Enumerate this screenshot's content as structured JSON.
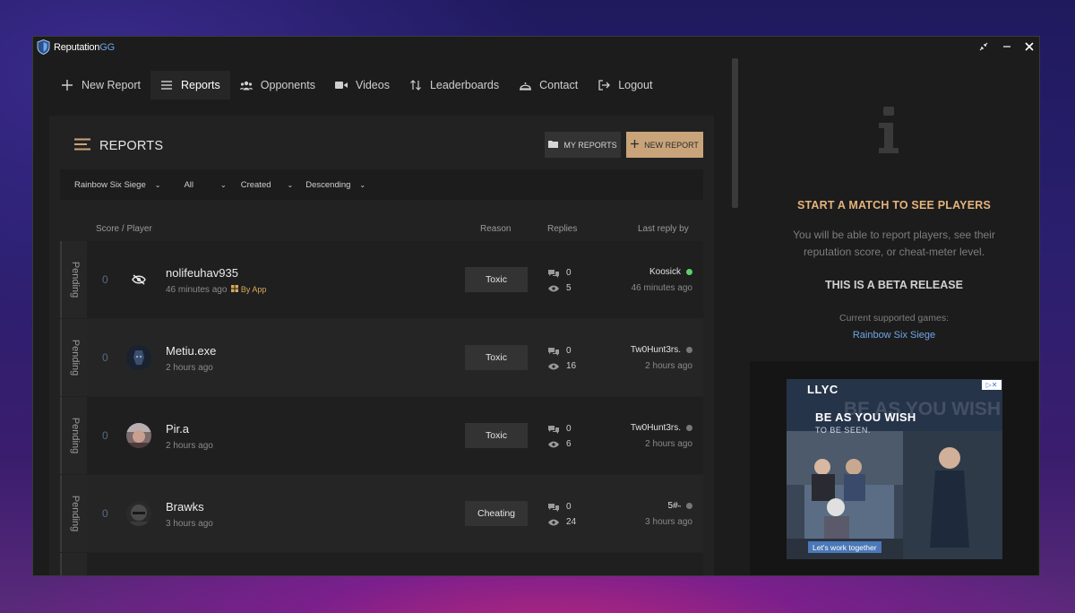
{
  "app": {
    "title_main": "Reputation",
    "title_accent": "GG"
  },
  "window_controls": [
    "restore",
    "minimize",
    "close"
  ],
  "nav": [
    {
      "label": "New Report",
      "icon": "plus-icon"
    },
    {
      "label": "Reports",
      "icon": "list-icon",
      "active": true
    },
    {
      "label": "Opponents",
      "icon": "users-icon"
    },
    {
      "label": "Videos",
      "icon": "video-icon"
    },
    {
      "label": "Leaderboards",
      "icon": "sort-icon"
    },
    {
      "label": "Contact",
      "icon": "bell-icon"
    },
    {
      "label": "Logout",
      "icon": "logout-icon"
    }
  ],
  "panel": {
    "title": "REPORTS",
    "my_reports_label": "MY REPORTS",
    "new_report_label": "NEW REPORT"
  },
  "filters": [
    {
      "value": "Rainbow Six Siege"
    },
    {
      "value": "All"
    },
    {
      "value": "Created"
    },
    {
      "value": "Descending"
    }
  ],
  "columns": {
    "score_player": "Score / Player",
    "reason": "Reason",
    "replies": "Replies",
    "last_reply_by": "Last reply by"
  },
  "rows": [
    {
      "status": "Pending",
      "score": "0",
      "player": "nolifeuhav935",
      "time": "46 minutes ago",
      "by_app": "By App",
      "reason": "Toxic",
      "replies": "0",
      "views": "5",
      "last_by": "Koosick",
      "last_online": true,
      "last_time": "46 minutes ago"
    },
    {
      "status": "Pending",
      "score": "0",
      "player": "Metiu.exe",
      "time": "2 hours ago",
      "by_app": "",
      "reason": "Toxic",
      "replies": "0",
      "views": "16",
      "last_by": "Tw0Hunt3rs.",
      "last_online": false,
      "last_time": "2 hours ago"
    },
    {
      "status": "Pending",
      "score": "0",
      "player": "Pir.a",
      "time": "2 hours ago",
      "by_app": "",
      "reason": "Toxic",
      "replies": "0",
      "views": "6",
      "last_by": "Tw0Hunt3rs.",
      "last_online": false,
      "last_time": "2 hours ago"
    },
    {
      "status": "Pending",
      "score": "0",
      "player": "Brawks",
      "time": "3 hours ago",
      "by_app": "",
      "reason": "Cheating",
      "replies": "0",
      "views": "24",
      "last_by": "5#˵",
      "last_online": false,
      "last_time": "3 hours ago"
    }
  ],
  "info": {
    "title": "START A MATCH TO SEE PLAYERS",
    "description": "You will be able to report players, see their reputation score, or cheat-meter level.",
    "beta": "THIS IS A BETA RELEASE",
    "games_label": "Current supported games:",
    "games_link": "Rainbow Six Siege"
  },
  "ad": {
    "brand": "LLYC",
    "headline": "BE AS YOU WISH",
    "subline": "TO BE SEEN.",
    "watermark": "BE AS YOU WISH",
    "cta": "Let's work together"
  },
  "colors": {
    "accent": "#c9a47a",
    "link": "#6ea6e8",
    "online": "#5fcf6a",
    "info_title": "#e5b37c"
  }
}
